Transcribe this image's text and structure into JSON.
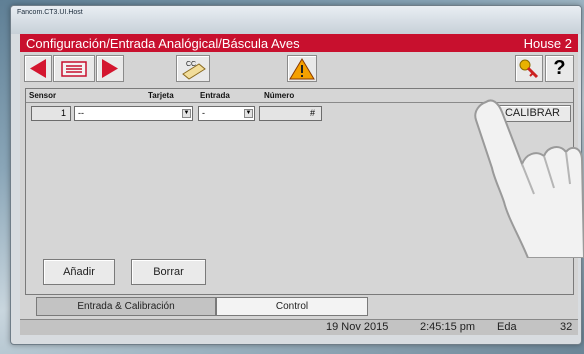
{
  "window": {
    "title": "Fancom.CT3.UI.Host"
  },
  "header": {
    "title": "Configuración/Entrada Analógical/Báscula Aves",
    "house": "House 2"
  },
  "toolbar": {
    "cc_label": "CC",
    "help_label": "?"
  },
  "table": {
    "headers": [
      "Sensor",
      "Tarjeta",
      "Entrada",
      "Número"
    ],
    "row": {
      "sensor": "1",
      "tarjeta": "--",
      "entrada": "-",
      "numero": "#"
    },
    "calibrate_label": "CALIBRAR"
  },
  "actions": {
    "add_label": "Añadir",
    "delete_label": "Borrar"
  },
  "tabs": [
    {
      "label": "Entrada & Calibración",
      "active": true
    },
    {
      "label": "Control",
      "active": false
    }
  ],
  "status": {
    "date": "19 Nov 2015",
    "time": "2:45:15 pm",
    "user": "Eda",
    "count": "32"
  },
  "colors": {
    "accent": "#c8102e",
    "warning": "#f5a000"
  }
}
